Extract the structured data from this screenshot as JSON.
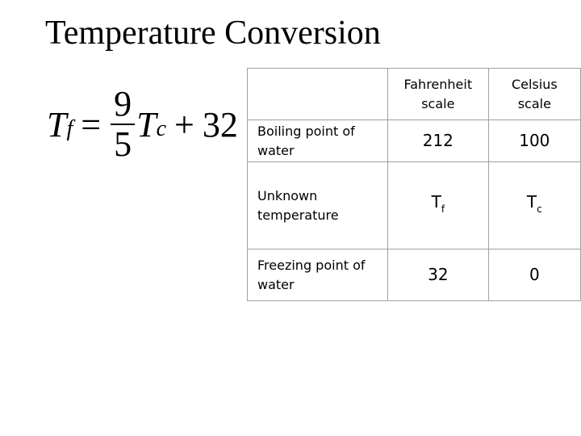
{
  "title": "Temperature Conversion",
  "formula": {
    "lhs": "T",
    "lhs_sub": "f",
    "equals": "=",
    "numerator": "9",
    "denominator": "5",
    "var": "T",
    "var_sub": "c",
    "plus": "+",
    "constant": "32"
  },
  "table": {
    "headers": [
      "",
      "Fahrenheit scale",
      "Celsius scale"
    ],
    "header_lines": {
      "fahrenheit": [
        "Fahrenheit",
        "scale"
      ],
      "celsius": [
        "Celsius",
        "scale"
      ]
    },
    "rows": [
      {
        "label": "Boiling point of water",
        "fahrenheit": "212",
        "celsius": "100"
      },
      {
        "label": "Unknown temperature",
        "fahrenheit": "T",
        "fahrenheit_sub": "f",
        "celsius": "T",
        "celsius_sub": "c"
      },
      {
        "label": "Freezing point of water",
        "fahrenheit": "32",
        "celsius": "0"
      }
    ]
  }
}
